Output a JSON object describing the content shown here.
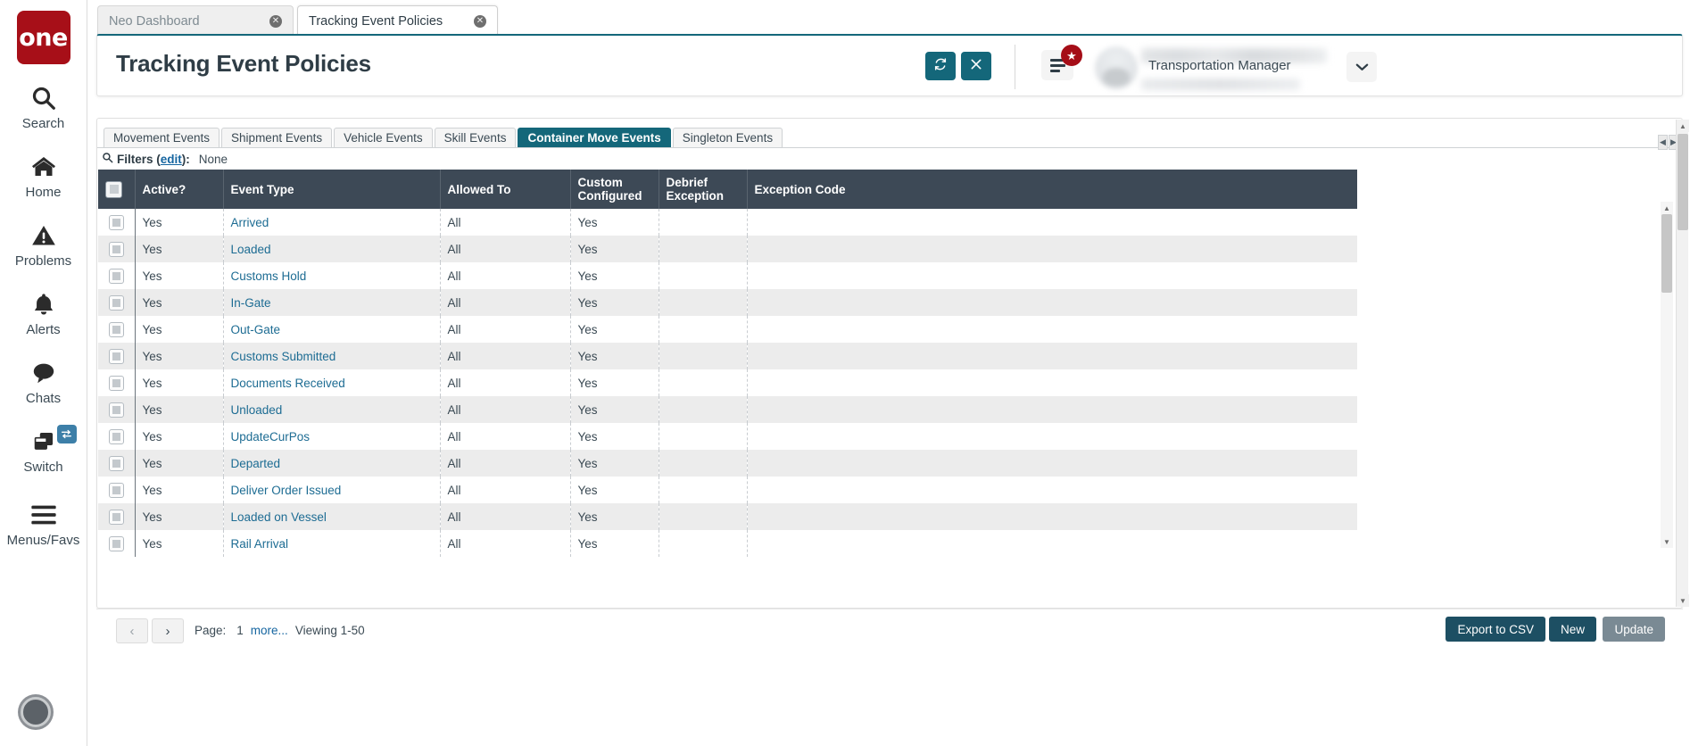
{
  "app": {
    "logo_text": "one",
    "brand_color": "#a70f18",
    "accent_color": "#14677a",
    "header_dark": "#3d4956"
  },
  "rail": {
    "items": [
      {
        "label": "Search",
        "icon": "search-icon"
      },
      {
        "label": "Home",
        "icon": "home-icon"
      },
      {
        "label": "Problems",
        "icon": "warning-triangle-icon"
      },
      {
        "label": "Alerts",
        "icon": "bell-icon"
      },
      {
        "label": "Chats",
        "icon": "chat-bubble-icon"
      },
      {
        "label": "Switch",
        "icon": "windows-stack-icon",
        "badge_icon": "swap-arrows-icon"
      },
      {
        "label": "Menus/Favs",
        "icon": "hamburger-icon"
      }
    ]
  },
  "browser_tabs": [
    {
      "label": "Neo Dashboard",
      "active": false,
      "close_icon": "close-circle-icon"
    },
    {
      "label": "Tracking Event Policies",
      "active": true,
      "close_icon": "close-circle-icon"
    }
  ],
  "header": {
    "title": "Tracking Event Policies",
    "refresh_icon": "refresh-icon",
    "close_icon": "close-x-icon",
    "menu_icon": "list-menu-icon",
    "badge_icon": "star-icon",
    "avatar": "user-avatar",
    "user_role": "Transportation Manager",
    "caret_icon": "chevron-down-icon"
  },
  "entity_tabs": [
    {
      "label": "Movement Events",
      "active": false
    },
    {
      "label": "Shipment Events",
      "active": false
    },
    {
      "label": "Vehicle Events",
      "active": false
    },
    {
      "label": "Skill Events",
      "active": false
    },
    {
      "label": "Container Move Events",
      "active": true
    },
    {
      "label": "Singleton Events",
      "active": false
    }
  ],
  "tab_scroll": {
    "left_icon": "◀",
    "right_icon": "▶"
  },
  "filters": {
    "icon": "search-icon",
    "label": "Filters (",
    "edit_link": "edit",
    "label_end": "):",
    "value": "None"
  },
  "table": {
    "select_all_icon": "checkbox-icon",
    "columns": [
      "Active?",
      "Event Type",
      "Allowed To",
      "Custom Configured",
      "Debrief Exception",
      "Exception Code"
    ],
    "rows": [
      {
        "active": "Yes",
        "event_type": "Arrived",
        "allowed_to": "All",
        "custom_configured": "Yes",
        "debrief_exception": "",
        "exception_code": ""
      },
      {
        "active": "Yes",
        "event_type": "Loaded",
        "allowed_to": "All",
        "custom_configured": "Yes",
        "debrief_exception": "",
        "exception_code": ""
      },
      {
        "active": "Yes",
        "event_type": "Customs Hold",
        "allowed_to": "All",
        "custom_configured": "Yes",
        "debrief_exception": "",
        "exception_code": ""
      },
      {
        "active": "Yes",
        "event_type": "In-Gate",
        "allowed_to": "All",
        "custom_configured": "Yes",
        "debrief_exception": "",
        "exception_code": ""
      },
      {
        "active": "Yes",
        "event_type": "Out-Gate",
        "allowed_to": "All",
        "custom_configured": "Yes",
        "debrief_exception": "",
        "exception_code": ""
      },
      {
        "active": "Yes",
        "event_type": "Customs Submitted",
        "allowed_to": "All",
        "custom_configured": "Yes",
        "debrief_exception": "",
        "exception_code": ""
      },
      {
        "active": "Yes",
        "event_type": "Documents Received",
        "allowed_to": "All",
        "custom_configured": "Yes",
        "debrief_exception": "",
        "exception_code": ""
      },
      {
        "active": "Yes",
        "event_type": "Unloaded",
        "allowed_to": "All",
        "custom_configured": "Yes",
        "debrief_exception": "",
        "exception_code": ""
      },
      {
        "active": "Yes",
        "event_type": "UpdateCurPos",
        "allowed_to": "All",
        "custom_configured": "Yes",
        "debrief_exception": "",
        "exception_code": ""
      },
      {
        "active": "Yes",
        "event_type": "Departed",
        "allowed_to": "All",
        "custom_configured": "Yes",
        "debrief_exception": "",
        "exception_code": ""
      },
      {
        "active": "Yes",
        "event_type": "Deliver Order Issued",
        "allowed_to": "All",
        "custom_configured": "Yes",
        "debrief_exception": "",
        "exception_code": ""
      },
      {
        "active": "Yes",
        "event_type": "Loaded on Vessel",
        "allowed_to": "All",
        "custom_configured": "Yes",
        "debrief_exception": "",
        "exception_code": ""
      },
      {
        "active": "Yes",
        "event_type": "Rail Arrival",
        "allowed_to": "All",
        "custom_configured": "Yes",
        "debrief_exception": "",
        "exception_code": ""
      }
    ]
  },
  "footer": {
    "prev_icon": "‹",
    "next_icon": "›",
    "page_label": "Page:",
    "page_number": "1",
    "more_link": "more...",
    "viewing": "Viewing 1-50",
    "export_label": "Export to CSV",
    "new_label": "New",
    "update_label": "Update"
  }
}
